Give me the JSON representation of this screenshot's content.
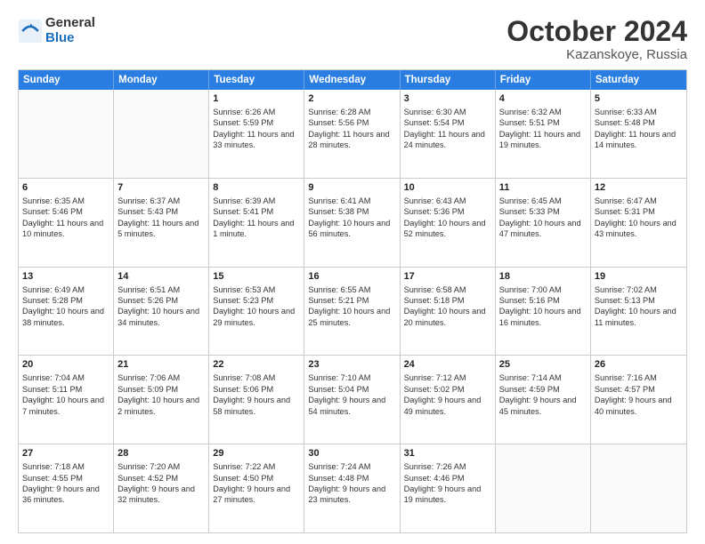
{
  "header": {
    "logo_general": "General",
    "logo_blue": "Blue",
    "month": "October 2024",
    "location": "Kazanskoye, Russia"
  },
  "days_of_week": [
    "Sunday",
    "Monday",
    "Tuesday",
    "Wednesday",
    "Thursday",
    "Friday",
    "Saturday"
  ],
  "weeks": [
    [
      {
        "day": "",
        "info": "",
        "empty": true
      },
      {
        "day": "",
        "info": "",
        "empty": true
      },
      {
        "day": "1",
        "sunrise": "Sunrise: 6:26 AM",
        "sunset": "Sunset: 5:59 PM",
        "daylight": "Daylight: 11 hours and 33 minutes."
      },
      {
        "day": "2",
        "sunrise": "Sunrise: 6:28 AM",
        "sunset": "Sunset: 5:56 PM",
        "daylight": "Daylight: 11 hours and 28 minutes."
      },
      {
        "day": "3",
        "sunrise": "Sunrise: 6:30 AM",
        "sunset": "Sunset: 5:54 PM",
        "daylight": "Daylight: 11 hours and 24 minutes."
      },
      {
        "day": "4",
        "sunrise": "Sunrise: 6:32 AM",
        "sunset": "Sunset: 5:51 PM",
        "daylight": "Daylight: 11 hours and 19 minutes."
      },
      {
        "day": "5",
        "sunrise": "Sunrise: 6:33 AM",
        "sunset": "Sunset: 5:48 PM",
        "daylight": "Daylight: 11 hours and 14 minutes."
      }
    ],
    [
      {
        "day": "6",
        "sunrise": "Sunrise: 6:35 AM",
        "sunset": "Sunset: 5:46 PM",
        "daylight": "Daylight: 11 hours and 10 minutes."
      },
      {
        "day": "7",
        "sunrise": "Sunrise: 6:37 AM",
        "sunset": "Sunset: 5:43 PM",
        "daylight": "Daylight: 11 hours and 5 minutes."
      },
      {
        "day": "8",
        "sunrise": "Sunrise: 6:39 AM",
        "sunset": "Sunset: 5:41 PM",
        "daylight": "Daylight: 11 hours and 1 minute."
      },
      {
        "day": "9",
        "sunrise": "Sunrise: 6:41 AM",
        "sunset": "Sunset: 5:38 PM",
        "daylight": "Daylight: 10 hours and 56 minutes."
      },
      {
        "day": "10",
        "sunrise": "Sunrise: 6:43 AM",
        "sunset": "Sunset: 5:36 PM",
        "daylight": "Daylight: 10 hours and 52 minutes."
      },
      {
        "day": "11",
        "sunrise": "Sunrise: 6:45 AM",
        "sunset": "Sunset: 5:33 PM",
        "daylight": "Daylight: 10 hours and 47 minutes."
      },
      {
        "day": "12",
        "sunrise": "Sunrise: 6:47 AM",
        "sunset": "Sunset: 5:31 PM",
        "daylight": "Daylight: 10 hours and 43 minutes."
      }
    ],
    [
      {
        "day": "13",
        "sunrise": "Sunrise: 6:49 AM",
        "sunset": "Sunset: 5:28 PM",
        "daylight": "Daylight: 10 hours and 38 minutes."
      },
      {
        "day": "14",
        "sunrise": "Sunrise: 6:51 AM",
        "sunset": "Sunset: 5:26 PM",
        "daylight": "Daylight: 10 hours and 34 minutes."
      },
      {
        "day": "15",
        "sunrise": "Sunrise: 6:53 AM",
        "sunset": "Sunset: 5:23 PM",
        "daylight": "Daylight: 10 hours and 29 minutes."
      },
      {
        "day": "16",
        "sunrise": "Sunrise: 6:55 AM",
        "sunset": "Sunset: 5:21 PM",
        "daylight": "Daylight: 10 hours and 25 minutes."
      },
      {
        "day": "17",
        "sunrise": "Sunrise: 6:58 AM",
        "sunset": "Sunset: 5:18 PM",
        "daylight": "Daylight: 10 hours and 20 minutes."
      },
      {
        "day": "18",
        "sunrise": "Sunrise: 7:00 AM",
        "sunset": "Sunset: 5:16 PM",
        "daylight": "Daylight: 10 hours and 16 minutes."
      },
      {
        "day": "19",
        "sunrise": "Sunrise: 7:02 AM",
        "sunset": "Sunset: 5:13 PM",
        "daylight": "Daylight: 10 hours and 11 minutes."
      }
    ],
    [
      {
        "day": "20",
        "sunrise": "Sunrise: 7:04 AM",
        "sunset": "Sunset: 5:11 PM",
        "daylight": "Daylight: 10 hours and 7 minutes."
      },
      {
        "day": "21",
        "sunrise": "Sunrise: 7:06 AM",
        "sunset": "Sunset: 5:09 PM",
        "daylight": "Daylight: 10 hours and 2 minutes."
      },
      {
        "day": "22",
        "sunrise": "Sunrise: 7:08 AM",
        "sunset": "Sunset: 5:06 PM",
        "daylight": "Daylight: 9 hours and 58 minutes."
      },
      {
        "day": "23",
        "sunrise": "Sunrise: 7:10 AM",
        "sunset": "Sunset: 5:04 PM",
        "daylight": "Daylight: 9 hours and 54 minutes."
      },
      {
        "day": "24",
        "sunrise": "Sunrise: 7:12 AM",
        "sunset": "Sunset: 5:02 PM",
        "daylight": "Daylight: 9 hours and 49 minutes."
      },
      {
        "day": "25",
        "sunrise": "Sunrise: 7:14 AM",
        "sunset": "Sunset: 4:59 PM",
        "daylight": "Daylight: 9 hours and 45 minutes."
      },
      {
        "day": "26",
        "sunrise": "Sunrise: 7:16 AM",
        "sunset": "Sunset: 4:57 PM",
        "daylight": "Daylight: 9 hours and 40 minutes."
      }
    ],
    [
      {
        "day": "27",
        "sunrise": "Sunrise: 7:18 AM",
        "sunset": "Sunset: 4:55 PM",
        "daylight": "Daylight: 9 hours and 36 minutes."
      },
      {
        "day": "28",
        "sunrise": "Sunrise: 7:20 AM",
        "sunset": "Sunset: 4:52 PM",
        "daylight": "Daylight: 9 hours and 32 minutes."
      },
      {
        "day": "29",
        "sunrise": "Sunrise: 7:22 AM",
        "sunset": "Sunset: 4:50 PM",
        "daylight": "Daylight: 9 hours and 27 minutes."
      },
      {
        "day": "30",
        "sunrise": "Sunrise: 7:24 AM",
        "sunset": "Sunset: 4:48 PM",
        "daylight": "Daylight: 9 hours and 23 minutes."
      },
      {
        "day": "31",
        "sunrise": "Sunrise: 7:26 AM",
        "sunset": "Sunset: 4:46 PM",
        "daylight": "Daylight: 9 hours and 19 minutes."
      },
      {
        "day": "",
        "info": "",
        "empty": true
      },
      {
        "day": "",
        "info": "",
        "empty": true
      }
    ]
  ]
}
